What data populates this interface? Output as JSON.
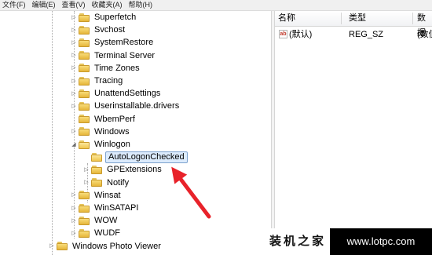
{
  "menu": [
    {
      "id": "file",
      "label": "文件(F)"
    },
    {
      "id": "edit",
      "label": "编辑(E)"
    },
    {
      "id": "view",
      "label": "查看(V)"
    },
    {
      "id": "favorites",
      "label": "收藏夹(A)"
    },
    {
      "id": "help",
      "label": "帮助(H)"
    }
  ],
  "tree": {
    "nodes": [
      {
        "label": "Superfetch",
        "level": 1,
        "expander": "collapsed"
      },
      {
        "label": "Svchost",
        "level": 1,
        "expander": "collapsed"
      },
      {
        "label": "SystemRestore",
        "level": 1,
        "expander": "collapsed"
      },
      {
        "label": "Terminal Server",
        "level": 1,
        "expander": "collapsed"
      },
      {
        "label": "Time Zones",
        "level": 1,
        "expander": "collapsed"
      },
      {
        "label": "Tracing",
        "level": 1,
        "expander": "collapsed"
      },
      {
        "label": "UnattendSettings",
        "level": 1,
        "expander": "collapsed"
      },
      {
        "label": "Userinstallable.drivers",
        "level": 1,
        "expander": "collapsed"
      },
      {
        "label": "WbemPerf",
        "level": 1,
        "expander": "none"
      },
      {
        "label": "Windows",
        "level": 1,
        "expander": "collapsed"
      },
      {
        "label": "Winlogon",
        "level": 1,
        "expander": "expanded"
      },
      {
        "label": "AutoLogonChecked",
        "level": 2,
        "expander": "none",
        "selected": true
      },
      {
        "label": "GPExtensions",
        "level": 2,
        "expander": "collapsed"
      },
      {
        "label": "Notify",
        "level": 2,
        "expander": "collapsed"
      },
      {
        "label": "Winsat",
        "level": 1,
        "expander": "collapsed"
      },
      {
        "label": "WinSATAPI",
        "level": 1,
        "expander": "collapsed"
      },
      {
        "label": "WOW",
        "level": 1,
        "expander": "collapsed"
      },
      {
        "label": "WUDF",
        "level": 1,
        "expander": "collapsed"
      },
      {
        "label": "Windows Photo Viewer",
        "level": 0,
        "expander": "collapsed"
      }
    ]
  },
  "values_pane": {
    "columns": [
      "名称",
      "类型",
      "数据"
    ],
    "rows": [
      {
        "icon": "string-value-icon",
        "icon_text": "ab",
        "name": "(默认)",
        "type": "REG_SZ",
        "data": "(数值"
      }
    ]
  },
  "watermark": {
    "left": "装机之家",
    "right": "www.lotpc.com"
  },
  "colors": {
    "selection_bg": "#dcebfc",
    "selection_border": "#7da2ce",
    "arrow": "#e8222a",
    "folder": "#f0c64e"
  },
  "icons": {
    "folder": "folder-icon",
    "expander_collapsed": "triangle-right-icon",
    "expander_expanded": "triangle-down-icon",
    "annotation": "red-arrow-icon"
  }
}
